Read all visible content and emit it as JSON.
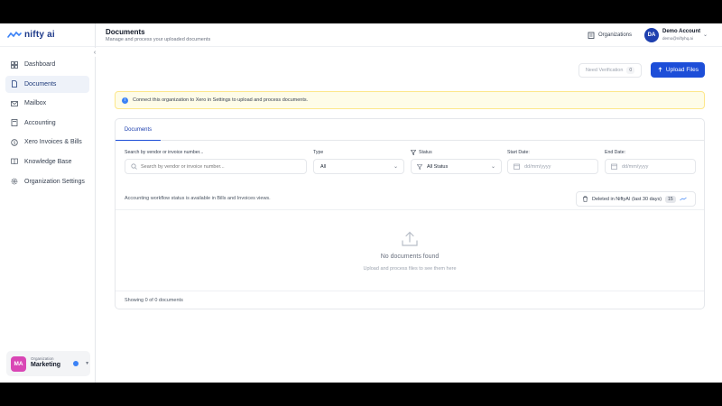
{
  "brand": {
    "name": "nifty ai",
    "accent": "#1d4ed8"
  },
  "sidebar": {
    "items": [
      {
        "label": "Dashboard",
        "icon": "grid-icon"
      },
      {
        "label": "Documents",
        "icon": "file-icon",
        "active": true
      },
      {
        "label": "Mailbox",
        "icon": "mail-icon"
      },
      {
        "label": "Accounting",
        "icon": "calculator-icon"
      },
      {
        "label": "Xero Invoices & Bills",
        "icon": "receipt-icon"
      },
      {
        "label": "Knowledge Base",
        "icon": "book-icon"
      },
      {
        "label": "Organization Settings",
        "icon": "gear-icon"
      }
    ],
    "org": {
      "initials": "MA",
      "caption": "Organization",
      "name": "Marketing"
    }
  },
  "header": {
    "title": "Documents",
    "subtitle": "Manage and process your uploaded documents",
    "organizations_label": "Organizations",
    "account": {
      "initials": "DA",
      "name": "Demo Account",
      "email": "demo@niftyhq.ai"
    }
  },
  "actions": {
    "verify_label": "Need Verification",
    "verify_count": "0",
    "upload_label": "Upload Files"
  },
  "banner": {
    "text": "Connect this organization to Xero in Settings to upload and process documents."
  },
  "tabs": [
    {
      "label": "Documents",
      "active": true
    }
  ],
  "filters": {
    "search_label": "Search by vendor or invoice number...",
    "search_placeholder": "Search by vendor or invoice number...",
    "type_label": "Type",
    "type_value": "All",
    "status_label": "Status",
    "status_value": "All Status",
    "start_label": "Start Date:",
    "start_placeholder": "dd/mm/yyyy",
    "end_label": "End Date:",
    "end_placeholder": "dd/mm/yyyy"
  },
  "info": {
    "text": "Accounting workflow status is available in Bills and Invoices views.",
    "deleted_label": "Deleted in NiftyAI (last 30 days)",
    "deleted_count": "15"
  },
  "empty": {
    "title": "No documents found",
    "subtitle": "Upload and process files to see them here"
  },
  "footer": {
    "text": "Showing 0 of 0 documents"
  }
}
